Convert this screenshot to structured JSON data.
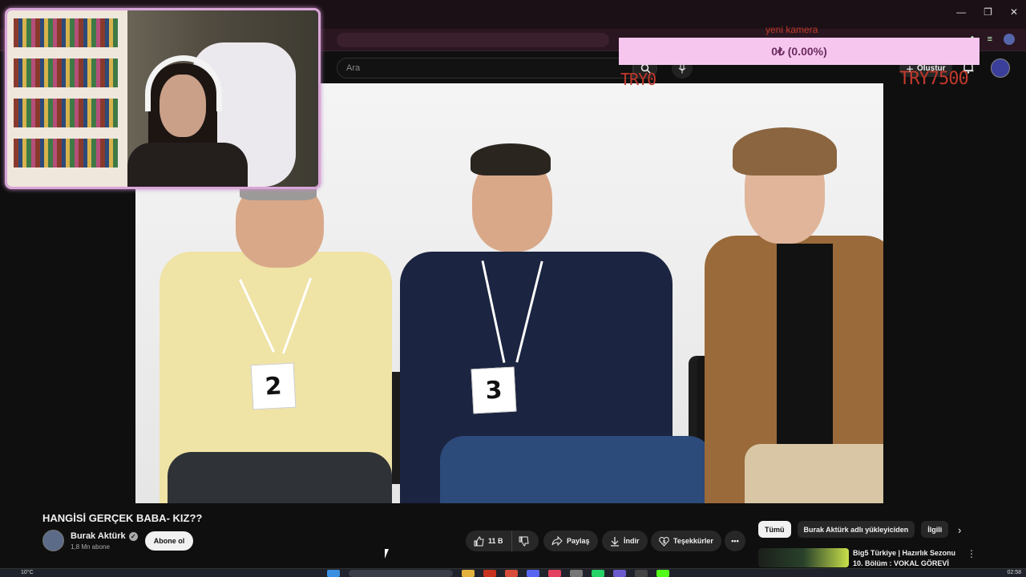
{
  "window": {
    "minimize_icon": "minimize-icon",
    "maximize_icon": "restore-icon",
    "close_icon": "close-icon"
  },
  "youtube": {
    "search_placeholder": "Ara",
    "create_label": "Oluştur",
    "video": {
      "title": "HANGİSİ GERÇEK BABA- KIZ??",
      "badges": [
        "2",
        "3"
      ]
    },
    "channel": {
      "name": "Burak Aktürk",
      "subscribers": "1,8 Mn abone",
      "subscribe_label": "Abone ol"
    },
    "actions": {
      "like_count": "11 B",
      "share_label": "Paylaş",
      "download_label": "İndir",
      "thanks_label": "Teşekkürler"
    },
    "chips": [
      "Tümü",
      "Burak Aktürk adlı yükleyiciden",
      "İlgili"
    ],
    "recommendation": {
      "title": "Big5 Türkiye | Hazırlık Sezonu 10. Bölüm : VOKAL GÖREVİ"
    }
  },
  "overlay": {
    "donation_label": "yeni kamera",
    "donation_amount": "0₺ (0.00%)",
    "goal_start": "TRY0",
    "goal_end": "TRY7500"
  },
  "taskbar": {
    "weather": "10°C",
    "clock": "02:58"
  },
  "colors": {
    "accent_overlay": "#f7c6ef",
    "goal_text": "#c0392b",
    "cam_border": "#d9a6d8"
  }
}
